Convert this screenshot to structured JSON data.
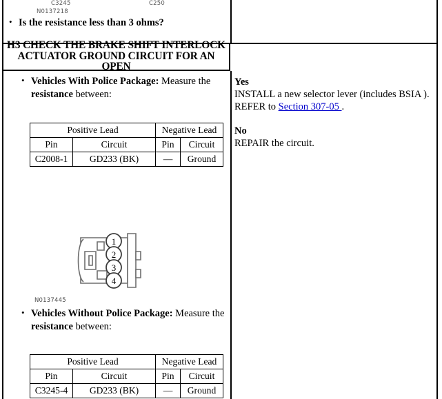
{
  "document": {
    "type": "vehicle-diagnostic-pinpoint-test"
  },
  "previous_step": {
    "connector_labels": [
      {
        "name": "C3245"
      },
      {
        "name": "C250"
      }
    ],
    "figure_id": "N0137218",
    "question": "Is the resistance less than 3 ohms?"
  },
  "step": {
    "id": "H3",
    "title": "H3 CHECK THE BRAKE SHIFT INTERLOCK ACTUATOR GROUND CIRCUIT FOR AN OPEN",
    "instructions": [
      {
        "lead_in_bold": "Vehicles With Police Package:",
        "text_before_bold": " Measure the ",
        "bold_word": "resistance",
        "text_after_bold": " between:"
      },
      {
        "lead_in_bold": "Vehicles Without Police Package:",
        "text_before_bold": " Measure the ",
        "bold_word": "resistance",
        "text_after_bold": " between:"
      }
    ],
    "figure": {
      "id": "N0137445",
      "description": "four-pin connector end view",
      "pins": [
        "1",
        "2",
        "3",
        "4"
      ]
    },
    "tables": [
      {
        "group_headers": [
          "Positive Lead",
          "Negative Lead"
        ],
        "column_headers": [
          "Pin",
          "Circuit",
          "Pin",
          "Circuit"
        ],
        "rows": [
          [
            "C2008-1",
            "GD233 (BK)",
            "—",
            "Ground"
          ]
        ]
      },
      {
        "group_headers": [
          "Positive Lead",
          "Negative Lead"
        ],
        "column_headers": [
          "Pin",
          "Circuit",
          "Pin",
          "Circuit"
        ],
        "rows": [
          [
            "C3245-4",
            "GD233 (BK)",
            "—",
            "Ground"
          ]
        ]
      }
    ],
    "results": {
      "yes": {
        "label": "Yes",
        "line1": "INSTALL a new selector lever (includes BSIA ).",
        "line2_prefix": "REFER to ",
        "link_text": "Section 307-05 ",
        "line2_suffix": "."
      },
      "no": {
        "label": "No",
        "line1": "REPAIR the circuit."
      }
    }
  },
  "colors": {
    "link": "#0000cc",
    "border": "#000000",
    "caption_text": "#5a5a5a",
    "page_background": "#ffffff"
  }
}
